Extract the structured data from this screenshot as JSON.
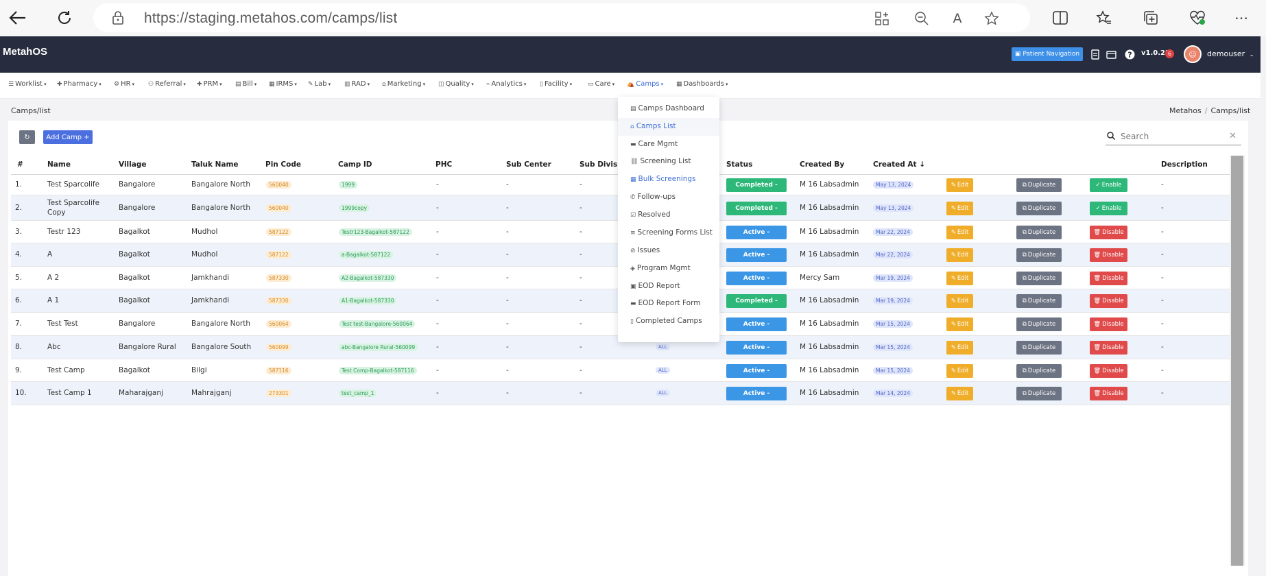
{
  "browser": {
    "url": "https://staging.metahos.com/camps/list"
  },
  "header": {
    "brand": "MetahOS",
    "patient_nav_label": "Patient Navigation",
    "version": "v1.0.22",
    "version_badge": "6",
    "user": "demouser"
  },
  "menu": [
    {
      "label": "Worklist",
      "icon": "list-icon"
    },
    {
      "label": "Pharmacy",
      "icon": "plus-icon"
    },
    {
      "label": "HR",
      "icon": "hr-icon"
    },
    {
      "label": "Referral",
      "icon": "users-icon"
    },
    {
      "label": "PRM",
      "icon": "plus-icon"
    },
    {
      "label": "Bill",
      "icon": "bill-icon"
    },
    {
      "label": "IRMS",
      "icon": "grid-icon"
    },
    {
      "label": "Lab",
      "icon": "pen-icon"
    },
    {
      "label": "RAD",
      "icon": "rad-icon"
    },
    {
      "label": "Marketing",
      "icon": "bag-icon"
    },
    {
      "label": "Quality",
      "icon": "quality-icon"
    },
    {
      "label": "Analytics",
      "icon": "analytics-icon"
    },
    {
      "label": "Facility",
      "icon": "facility-icon"
    },
    {
      "label": "Care",
      "icon": "care-icon"
    },
    {
      "label": "Camps",
      "icon": "camp-icon"
    },
    {
      "label": "Dashboards",
      "icon": "dashboard-icon"
    }
  ],
  "breadcrumb": {
    "left": "Camps/list",
    "home": "Metahos",
    "current": "Camps/list"
  },
  "toolbar": {
    "refresh_icon": "refresh-icon",
    "add_label": "Add Camp +",
    "search_placeholder": "Search"
  },
  "table": {
    "headers": [
      "#",
      "Name",
      "Village",
      "Taluk Name",
      "Pin Code",
      "Camp ID",
      "PHC",
      "Sub Center",
      "Sub Division",
      "Status",
      "Created By",
      "Created At",
      "Description"
    ],
    "action_labels": {
      "edit": "Edit",
      "duplicate": "Duplicate",
      "enable": "Enable",
      "disable": "Disable"
    },
    "rows": [
      {
        "n": "1.",
        "name": "Test Sparcolife",
        "village": "Bangalore",
        "taluk": "Bangalore North",
        "pin": "560040",
        "camp_id": "1999",
        "phc": "-",
        "subcenter": "-",
        "subdivision": "-",
        "status": "Completed -",
        "created_by": "M 16 Labsadmin",
        "created_at": "May 13, 2024",
        "toggle": "Enable",
        "desc": "-"
      },
      {
        "n": "2.",
        "name": "Test Sparcolife Copy",
        "village": "Bangalore",
        "taluk": "Bangalore North",
        "pin": "560040",
        "camp_id": "1999copy",
        "phc": "-",
        "subcenter": "-",
        "subdivision": "-",
        "status": "Completed -",
        "created_by": "M 16 Labsadmin",
        "created_at": "May 13, 2024",
        "toggle": "Enable",
        "desc": "-"
      },
      {
        "n": "3.",
        "name": "Testr 123",
        "village": "Bagalkot",
        "taluk": "Mudhol",
        "pin": "587122",
        "camp_id": "Testr123-Bagalkot-587122",
        "phc": "-",
        "subcenter": "-",
        "subdivision": "-",
        "status": "Active -",
        "created_by": "M 16 Labsadmin",
        "created_at": "Mar 22, 2024",
        "toggle": "Disable",
        "desc": "-"
      },
      {
        "n": "4.",
        "name": "A",
        "village": "Bagalkot",
        "taluk": "Mudhol",
        "pin": "587122",
        "camp_id": "a-Bagalkot-587122",
        "phc": "-",
        "subcenter": "-",
        "subdivision": "-",
        "status": "Active -",
        "created_by": "M 16 Labsadmin",
        "created_at": "Mar 22, 2024",
        "toggle": "Disable",
        "desc": "-"
      },
      {
        "n": "5.",
        "name": "A 2",
        "village": "Bagalkot",
        "taluk": "Jamkhandi",
        "pin": "587330",
        "camp_id": "A2-Bagalkot-587330",
        "phc": "-",
        "subcenter": "-",
        "subdivision": "-",
        "status": "Active -",
        "created_by": "Mercy Sam",
        "created_at": "Mar 19, 2024",
        "toggle": "Disable",
        "desc": "-"
      },
      {
        "n": "6.",
        "name": "A 1",
        "village": "Bagalkot",
        "taluk": "Jamkhandi",
        "pin": "587330",
        "camp_id": "A1-Bagalkot-587330",
        "phc": "-",
        "subcenter": "-",
        "subdivision": "-",
        "status": "Completed -",
        "created_by": "M 16 Labsadmin",
        "created_at": "Mar 19, 2024",
        "toggle": "Disable",
        "desc": "-"
      },
      {
        "n": "7.",
        "name": "Test Test",
        "village": "Bangalore",
        "taluk": "Bangalore North",
        "pin": "560064",
        "camp_id": "Test test-Bangalore-560064",
        "phc": "-",
        "subcenter": "-",
        "subdivision": "-",
        "status": "Active -",
        "created_by": "M 16 Labsadmin",
        "created_at": "Mar 15, 2024",
        "toggle": "Disable",
        "desc": "-"
      },
      {
        "n": "8.",
        "name": "Abc",
        "village": "Bangalore Rural",
        "taluk": "Bangalore South",
        "pin": "560099",
        "camp_id": "abc-Bangalore Rural-560099",
        "phc": "-",
        "subcenter": "-",
        "subdivision": "-",
        "extra": "ALL",
        "status": "Active -",
        "created_by": "M 16 Labsadmin",
        "created_at": "Mar 15, 2024",
        "toggle": "Disable",
        "desc": "-"
      },
      {
        "n": "9.",
        "name": "Test Camp",
        "village": "Bagalkot",
        "taluk": "Bilgi",
        "pin": "587116",
        "camp_id": "Test Comp-Bagalkot-587116",
        "phc": "-",
        "subcenter": "-",
        "subdivision": "-",
        "extra": "ALL",
        "status": "Active -",
        "created_by": "M 16 Labsadmin",
        "created_at": "Mar 15, 2024",
        "toggle": "Disable",
        "desc": "-"
      },
      {
        "n": "10.",
        "name": "Test Camp 1",
        "village": "Maharajganj",
        "taluk": "Mahrajganj",
        "pin": "273301",
        "camp_id": "test_camp_1",
        "phc": "-",
        "subcenter": "-",
        "subdivision": "-",
        "extra": "ALL",
        "status": "Active -",
        "created_by": "M 16 Labsadmin",
        "created_at": "Mar 14, 2024",
        "toggle": "Disable",
        "desc": "-"
      }
    ]
  },
  "camps_dropdown": [
    {
      "label": "Camps Dashboard",
      "icon": "dashboard-icon"
    },
    {
      "label": "Camps List",
      "icon": "camp-icon"
    },
    {
      "label": "Care Mgmt",
      "icon": "care-icon"
    },
    {
      "label": "Screening List",
      "icon": "link-icon"
    },
    {
      "label": "Bulk Screenings",
      "icon": "grid-icon"
    },
    {
      "label": "Follow-ups",
      "icon": "phone-icon"
    },
    {
      "label": "Resolved",
      "icon": "check-box-icon"
    },
    {
      "label": "Screening Forms List",
      "icon": "list-icon"
    },
    {
      "label": "Issues",
      "icon": "issue-icon"
    },
    {
      "label": "Program Mgmt",
      "icon": "program-icon"
    },
    {
      "label": "EOD Report",
      "icon": "report-icon"
    },
    {
      "label": "EOD Report Form",
      "icon": "form-icon"
    },
    {
      "label": "Completed Camps",
      "icon": "document-icon"
    }
  ],
  "colors": {
    "header_bg": "#272d3e",
    "accent": "#3d6fd8",
    "completed": "#2db87a",
    "active": "#3b96e6",
    "edit": "#f0ad2a",
    "duplicate": "#6c7382",
    "disable": "#e04a4a"
  }
}
